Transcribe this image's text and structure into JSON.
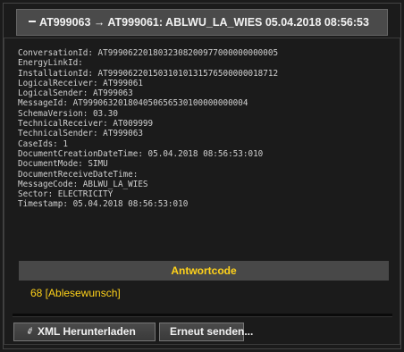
{
  "header": {
    "collapse_icon": "collapse-minus-icon",
    "title": "AT999063 → AT999061: ABLWU_LA_WIES 05.04.2018 08:56:53"
  },
  "details": [
    "ConversationId: AT9990622018032308200977000000000005",
    "EnergyLinkId:",
    "InstallationId: AT9990622015031010131576500000018712",
    "LogicalReceiver: AT999061",
    "LogicalSender: AT999063",
    "MessageId: AT999063201804050656530100000000004",
    "SchemaVersion: 03.30",
    "TechnicalReceiver: AT009999",
    "TechnicalSender: AT999063",
    "CaseIds: 1",
    "DocumentCreationDateTime: 05.04.2018 08:56:53:010",
    "DocumentMode: SIMU",
    "DocumentReceiveDateTime:",
    "MessageCode: ABLWU_LA_WIES",
    "Sector: ELECTRICITY",
    "Timestamp: 05.04.2018 08:56:53:010"
  ],
  "antwortcode": {
    "header": "Antwortcode",
    "value": "68 [Ablesewunsch]",
    "accent_color": "#ffd21a"
  },
  "buttons": {
    "download_icon": "download-icon",
    "download_label": "XML Herunterladen",
    "resend_label": "Erneut senden..."
  }
}
